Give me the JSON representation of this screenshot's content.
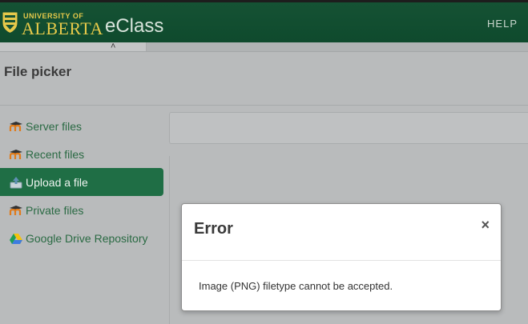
{
  "header": {
    "university_small": "UNIVERSITY OF",
    "university_big": "ALBERTA",
    "app_name": "eClass",
    "help_label": "HELP"
  },
  "strip": {
    "caret": "˄"
  },
  "page": {
    "title": "File picker"
  },
  "sidebar": {
    "items": [
      {
        "label": "Server files",
        "icon": "moodle-icon",
        "active": false
      },
      {
        "label": "Recent files",
        "icon": "moodle-icon",
        "active": false
      },
      {
        "label": "Upload a file",
        "icon": "upload-icon",
        "active": true
      },
      {
        "label": "Private files",
        "icon": "moodle-icon",
        "active": false
      },
      {
        "label": "Google Drive Repository",
        "icon": "google-drive-icon",
        "active": false
      }
    ]
  },
  "dialog": {
    "title": "Error",
    "close_glyph": "×",
    "message": "Image (PNG) filetype cannot be accepted."
  },
  "colors": {
    "brand_green": "#155234",
    "brand_gold": "#e6c94a",
    "active_item": "#1f6e45"
  }
}
